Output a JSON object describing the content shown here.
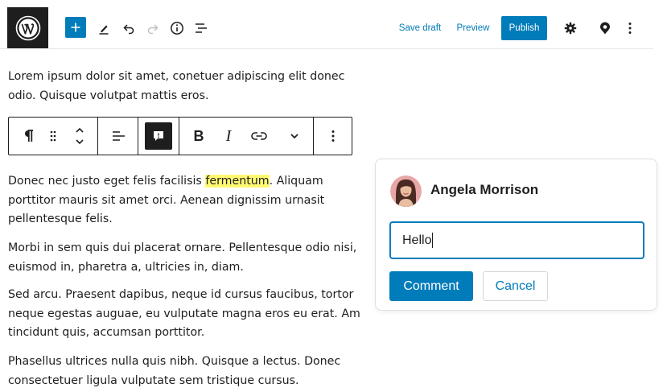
{
  "header": {
    "logo_icon": "wordpress-logo-icon",
    "add_block_icon": "plus-icon",
    "tools_icon": "pencil-icon",
    "undo_icon": "undo-icon",
    "redo_icon": "redo-icon",
    "details_icon": "info-icon",
    "list_view_icon": "list-view-icon",
    "save_draft_label": "Save draft",
    "preview_label": "Preview",
    "publish_label": "Publish",
    "settings_icon": "gear-icon",
    "plugin_icon": "location-pin-icon",
    "more_icon": "vertical-ellipsis-icon",
    "accent_color": "#007cba"
  },
  "content": {
    "paragraph_1": "Lorem ipsum dolor sit amet, conetuer adipiscing elit donec odio. Quisque volutpat mattis eros.",
    "paragraph_2_before": "Donec nec justo eget felis facilisis ",
    "paragraph_2_highlight": "fermentum",
    "paragraph_2_after": ". Aliquam porttitor mauris sit amet orci. Aenean dignissim urnasit pellentesque felis.",
    "paragraph_3": "Morbi in sem quis dui placerat ornare. Pellentesque odio nisi, euismod in, pharetra a, ultricies in, diam.",
    "paragraph_4": "Sed arcu. Praesent dapibus, neque id cursus faucibus, tortor neque egestas auguae, eu vulputate magna eros eu erat. Am tincidunt quis, accumsan porttitor.",
    "paragraph_5": "Phasellus ultrices nulla quis nibh. Quisque a lectus. Donec consectetuer ligula vulputate sem tristique cursus.",
    "highlight_color": "#fff972"
  },
  "block_toolbar": {
    "paragraph_icon": "pilcrow-icon",
    "drag_icon": "drag-handle-icon",
    "move_icon": "move-up-down-icon",
    "align_icon": "align-left-icon",
    "comment_icon": "comment-icon",
    "bold_label": "B",
    "italic_label": "I",
    "link_icon": "link-icon",
    "more_rich_icon": "chevron-down-icon",
    "options_icon": "vertical-ellipsis-icon"
  },
  "comment": {
    "author": "Angela Morrison",
    "avatar_icon": "avatar",
    "input_value": "Hello",
    "submit_label": "Comment",
    "cancel_label": "Cancel"
  }
}
